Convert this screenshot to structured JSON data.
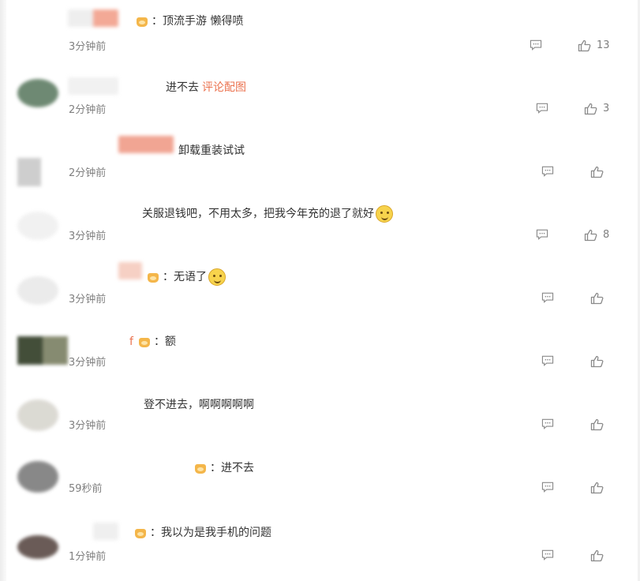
{
  "comments": [
    {
      "text": "：顶流手游 懒得喷",
      "time": "3分钟前",
      "likes": "13",
      "has_badge": true
    },
    {
      "text": "进不去",
      "link": "评论配图",
      "time": "2分钟前",
      "likes": "3",
      "has_badge": false
    },
    {
      "text": "卸载重装试试",
      "time": "2分钟前",
      "likes": "",
      "has_badge": false
    },
    {
      "text": "关服退钱吧，不用太多，把我今年充的退了就好",
      "time": "3分钟前",
      "likes": "8",
      "has_badge": false,
      "emoji": "thinking-emoji"
    },
    {
      "text": "：无语了",
      "time": "3分钟前",
      "likes": "",
      "has_badge": true,
      "emoji": "smile-emoji"
    },
    {
      "text": "：额",
      "time": "3分钟前",
      "likes": "",
      "has_badge": true
    },
    {
      "text": "登不进去，啊啊啊啊啊",
      "time": "3分钟前",
      "likes": "",
      "has_badge": false
    },
    {
      "text": "：进不去",
      "time": "59秒前",
      "likes": "",
      "has_badge": true
    },
    {
      "text": "：我以为是我手机的问题",
      "time": "1分钟前",
      "likes": "",
      "has_badge": true
    }
  ],
  "icons": {
    "reply": "comment-icon",
    "like": "thumbs-up-icon",
    "badge": "member-crown-icon"
  },
  "colors": {
    "link": "#eb7350",
    "meta": "#808080",
    "text": "#333333"
  }
}
